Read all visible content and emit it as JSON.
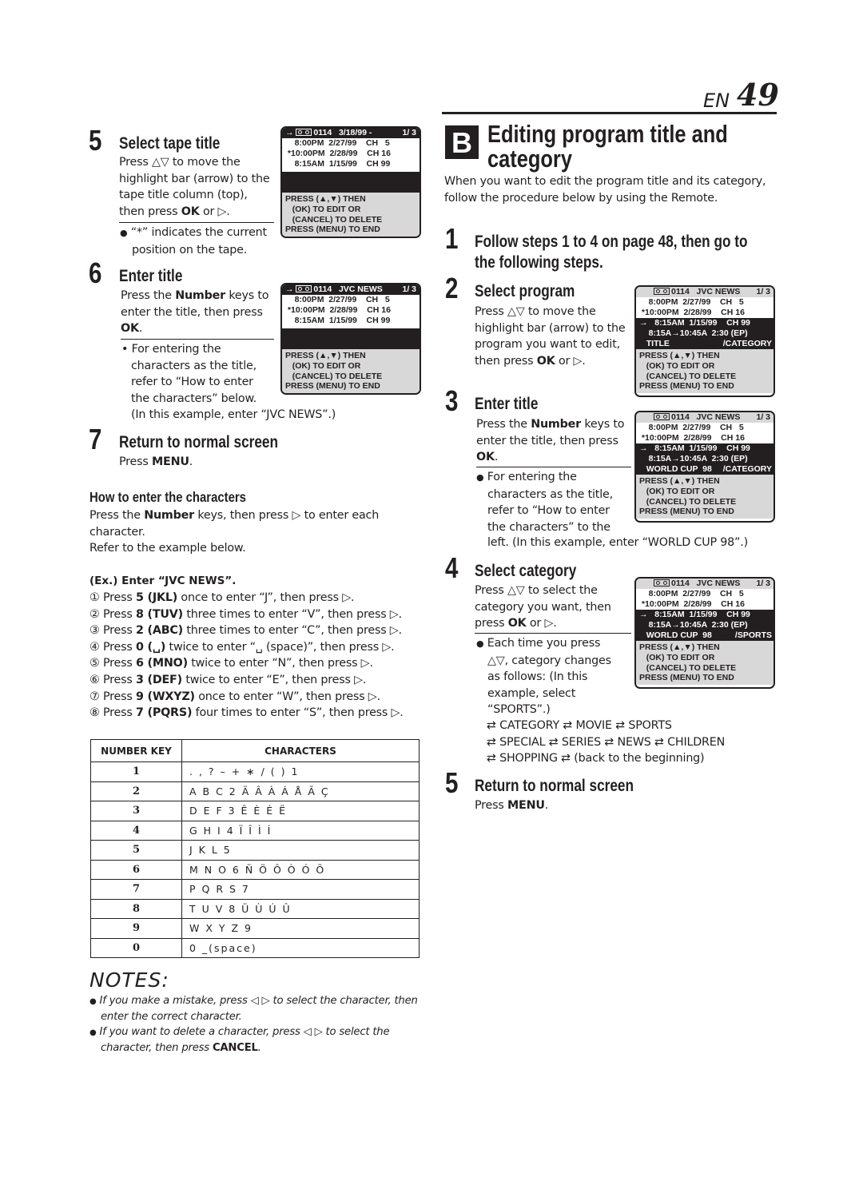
{
  "header": {
    "lang": "EN",
    "page": "49"
  },
  "left": {
    "step5": {
      "num": "5",
      "title": "Select tape title",
      "lines": [
        "Press △▽ to move the",
        "highlight bar (arrow) to the",
        "tape title column (top),"
      ],
      "last_pre": "then press ",
      "last_bold": "OK",
      "last_post": " or ▷.",
      "bullet_1": "“*” indicates the current",
      "bullet_2": "position on the tape."
    },
    "step6": {
      "num": "6",
      "title": "Enter title",
      "l1_pre": "Press the ",
      "l1_bold": "Number",
      "l1_post": " keys to",
      "l2": "enter the title, then press",
      "l3_bold": "OK",
      "l3_post": ".",
      "bullet": [
        "For entering the",
        "characters as the title,",
        "refer to “How to enter",
        "the characters” below."
      ],
      "example": "(In this example, enter “JVC NEWS”.)"
    },
    "step7": {
      "num": "7",
      "title": "Return to normal screen",
      "pre": "Press ",
      "bold": "MENU",
      "post": "."
    },
    "howto": {
      "title": "How to enter the characters",
      "l1_pre": "Press the ",
      "l1_bold": "Number",
      "l1_post": " keys, then press ▷ to enter each",
      "l2": "character.",
      "l3": "Refer to the example below."
    },
    "example": {
      "title": "(Ex.) Enter “JVC NEWS”.",
      "steps": [
        {
          "mark": "①",
          "key": "5 (JKL)",
          "text": " once to enter “J”, then press ▷."
        },
        {
          "mark": "②",
          "key": "8 (TUV)",
          "text": " three times to enter “V”, then press ▷."
        },
        {
          "mark": "③",
          "key": "2 (ABC)",
          "text": " three times to enter “C”, then press ▷."
        },
        {
          "mark": "④",
          "key": "0 (␣)",
          "text": " twice to enter “␣ (space)”, then press ▷."
        },
        {
          "mark": "⑤",
          "key": "6 (MNO)",
          "text": " twice to enter “N”, then press ▷."
        },
        {
          "mark": "⑥",
          "key": "3 (DEF)",
          "text": " twice to enter “E”, then press ▷."
        },
        {
          "mark": "⑦",
          "key": "9 (WXYZ)",
          "text": " once to enter “W”, then press ▷."
        },
        {
          "mark": "⑧",
          "key": "7 (PQRS)",
          "text": " four times to enter “S”, then press ▷."
        }
      ],
      "press": "Press "
    },
    "table": {
      "headers": [
        "NUMBER KEY",
        "CHARACTERS"
      ],
      "rows": [
        {
          "key": "1",
          "chars": ". , ? – + ∗ / ( ) 1"
        },
        {
          "key": "2",
          "chars": "A B C 2 Ä Â À Á Å Ã Ç"
        },
        {
          "key": "3",
          "chars": "D E F 3 Ê È É Ë"
        },
        {
          "key": "4",
          "chars": "G H I 4 Ï Î Ì Í"
        },
        {
          "key": "5",
          "chars": "J K L 5"
        },
        {
          "key": "6",
          "chars": "M N O 6 Ñ Ö Ô Ò Ó Õ"
        },
        {
          "key": "7",
          "chars": "P Q R S 7"
        },
        {
          "key": "8",
          "chars": "T U V 8 Ü Ù Ú Û"
        },
        {
          "key": "9",
          "chars": "W X Y Z 9"
        },
        {
          "key": "0",
          "chars": "0  _(space)"
        }
      ]
    },
    "notes": {
      "title": "NOTES:",
      "n1_a": "If you make a mistake, press ◁ ▷ to select the character, then",
      "n1_b": "enter the correct character.",
      "n2_a": "If you want to delete a character, press ◁ ▷ to select the",
      "n2_b_pre": "character, then press ",
      "n2_b_bold": "CANCEL",
      "n2_b_post": "."
    }
  },
  "right": {
    "section": {
      "letter": "B",
      "title_1": "Editing program title and",
      "title_2": "category",
      "intro_1": "When you want to edit the program title and its category,",
      "intro_2": "follow the procedure below by using the Remote."
    },
    "step1": {
      "num": "1",
      "title_1": "Follow steps 1 to 4 on page 48, then go to",
      "title_2": "the following steps."
    },
    "step2": {
      "num": "2",
      "title": "Select program",
      "lines": [
        "Press △▽ to move the",
        "highlight bar (arrow) to the",
        "program you want to edit,"
      ],
      "last_pre": "then press ",
      "last_bold": "OK",
      "last_post": " or ▷."
    },
    "step3": {
      "num": "3",
      "title": "Enter title",
      "l1_pre": "Press the ",
      "l1_bold": "Number",
      "l1_post": " keys to",
      "l2": "enter the title, then press",
      "l3_bold": "OK",
      "l3_post": ".",
      "bullet": [
        "For entering the",
        "characters as the title,",
        "refer to “How to enter",
        "the characters” to the"
      ],
      "example": "left. (In this example, enter “WORLD CUP 98”.)"
    },
    "step4": {
      "num": "4",
      "title": "Select category",
      "lines": [
        "Press △▽ to select the",
        "category you want, then"
      ],
      "last_pre": "press ",
      "last_bold": "OK",
      "last_post": " or ▷.",
      "bullet": [
        "Each time you press",
        "△▽, category changes",
        "as follows: (In this",
        "example, select",
        "“SPORTS”.)"
      ],
      "cycle_1": "⇄ CATEGORY ⇄ MOVIE ⇄ SPORTS",
      "cycle_2": "⇄ SPECIAL ⇄ SERIES ⇄ NEWS ⇄ CHILDREN",
      "cycle_3": "⇄ SHOPPING ⇄ (back to the beginning)"
    },
    "step5": {
      "num": "5",
      "title": "Return to normal screen",
      "pre": "Press ",
      "bold": "MENU",
      "post": "."
    }
  },
  "screens": {
    "s1": {
      "header_left": "→ ",
      "header_title": "0114   3/18/99 -",
      "header_right": "1/ 3",
      "rows": [
        "    8:00PM  2/27/99    CH   5",
        " *10:00PM  2/28/99    CH 16",
        "    8:15AM  1/15/99    CH 99"
      ]
    },
    "s2": {
      "header_left": "→ ",
      "header_title": "0114   JVC NEWS",
      "header_right": "1/ 3",
      "rows": [
        "    8:00PM  2/27/99    CH   5",
        " *10:00PM  2/28/99    CH 16",
        "    8:15AM  1/15/99    CH 99"
      ]
    },
    "s3": {
      "header_title": "0114   JVC NEWS",
      "header_right": "1/ 3",
      "rows": [
        "    8:00PM  2/27/99    CH   5",
        " *10:00PM  2/28/99    CH 16"
      ],
      "sel": "→   8:15AM  1/15/99    CH 99",
      "time": "    8:15A→10:45A  2:30 (EP)",
      "title": "   TITLE",
      "category": "/CATEGORY"
    },
    "s4": {
      "header_title": "0114   JVC NEWS",
      "header_right": "1/ 3",
      "rows": [
        "    8:00PM  2/27/99    CH   5",
        " *10:00PM  2/28/99    CH 16"
      ],
      "sel": "→   8:15AM  1/15/99    CH 99",
      "time": "    8:15A→10:45A  2:30 (EP)",
      "title": "   WORLD CUP  98",
      "category": "/CATEGORY"
    },
    "s5": {
      "header_title": "0114   JVC NEWS",
      "header_right": "1/ 3",
      "rows": [
        "    8:00PM  2/27/99    CH   5",
        " *10:00PM  2/28/99    CH 16"
      ],
      "sel": "→   8:15AM  1/15/99    CH 99",
      "time": "    8:15A→10:45A  2:30 (EP)",
      "title": "   WORLD CUP  98",
      "category": "/SPORTS"
    },
    "msg": [
      "PRESS (▲,▼) THEN",
      "   (OK) TO EDIT OR",
      "   (CANCEL) TO DELETE",
      "PRESS (MENU) TO END"
    ]
  }
}
